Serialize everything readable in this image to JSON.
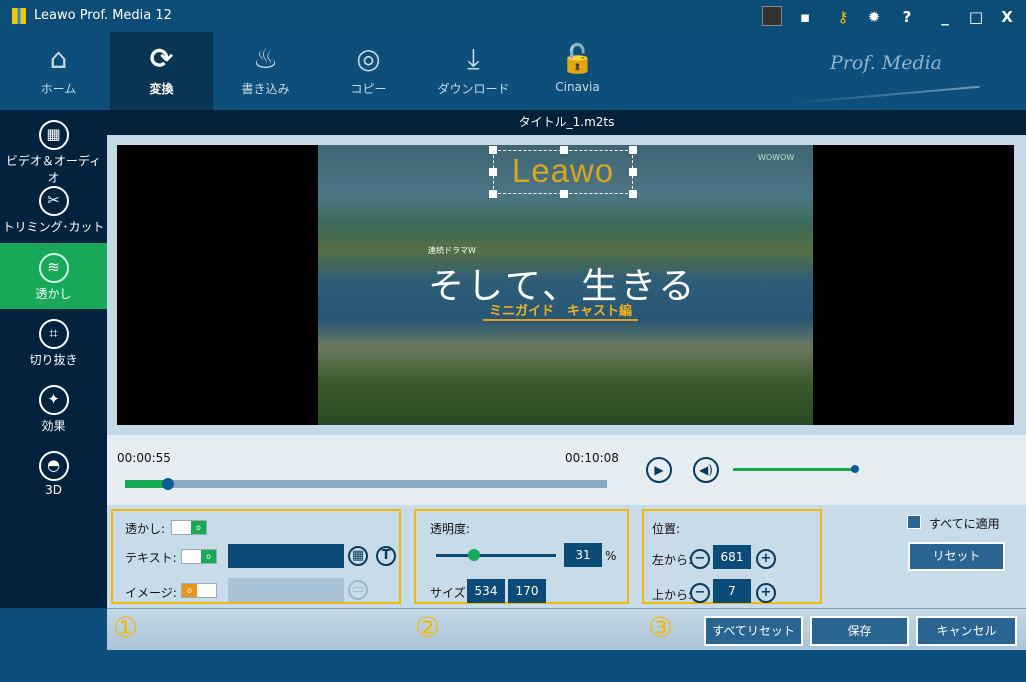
{
  "app": {
    "title": "Leawo Prof. Media 12",
    "brand": "Prof. Media"
  },
  "window_controls": [
    "minimize",
    "maximize",
    "close"
  ],
  "toolbar": {
    "tabs": [
      {
        "label": "ホーム",
        "icon": "home-icon"
      },
      {
        "label": "変換",
        "icon": "convert-icon",
        "active": true
      },
      {
        "label": "書き込み",
        "icon": "burn-icon"
      },
      {
        "label": "コピー",
        "icon": "copy-icon"
      },
      {
        "label": "ダウンロード",
        "icon": "download-icon"
      },
      {
        "label": "Cinavia",
        "icon": "cinavia-icon"
      }
    ]
  },
  "sidebar": {
    "items": [
      {
        "label": "ビデオ＆オーディオ"
      },
      {
        "label": "トリミング･カット"
      },
      {
        "label": "透かし",
        "active": true
      },
      {
        "label": "切り抜き"
      },
      {
        "label": "効果"
      },
      {
        "label": "3D"
      }
    ]
  },
  "file_title": "タイトル_1.m2ts",
  "video": {
    "watermark_text": "Leawo",
    "caption": "そして、生きる",
    "subcaption": "ミニガイド　キャスト編",
    "small_logo": "連続ドラマW",
    "corner_logo": "WOWOW"
  },
  "player": {
    "current_time": "00:00:55",
    "total_time": "00:10:08",
    "progress_fraction": 0.09,
    "volume_fraction": 1.0
  },
  "watermark": {
    "label": "透かし:",
    "text_label": "テキスト:",
    "text_value": "",
    "image_label": "イメージ:",
    "image_value": "",
    "enabled": true,
    "text_enabled": true,
    "image_enabled": false
  },
  "transparency": {
    "label": "透明度:",
    "value": "31",
    "unit": "%",
    "fraction": 0.31,
    "size_label": "サイズ:",
    "width": "534",
    "height": "170"
  },
  "position": {
    "label": "位置:",
    "left_label": "左から:",
    "left_value": "681",
    "top_label": "上から:",
    "top_value": "7"
  },
  "apply_all": {
    "label": "すべてに適用"
  },
  "reset_label": "リセット",
  "section_numbers": [
    "①",
    "②",
    "③"
  ],
  "buttons": {
    "reset_all": "すべてリセット",
    "save": "保存",
    "cancel": "キャンセル"
  },
  "colors": {
    "accent_green": "#17a957",
    "highlight_orange": "#f5b800",
    "navy": "#0c4a78"
  }
}
